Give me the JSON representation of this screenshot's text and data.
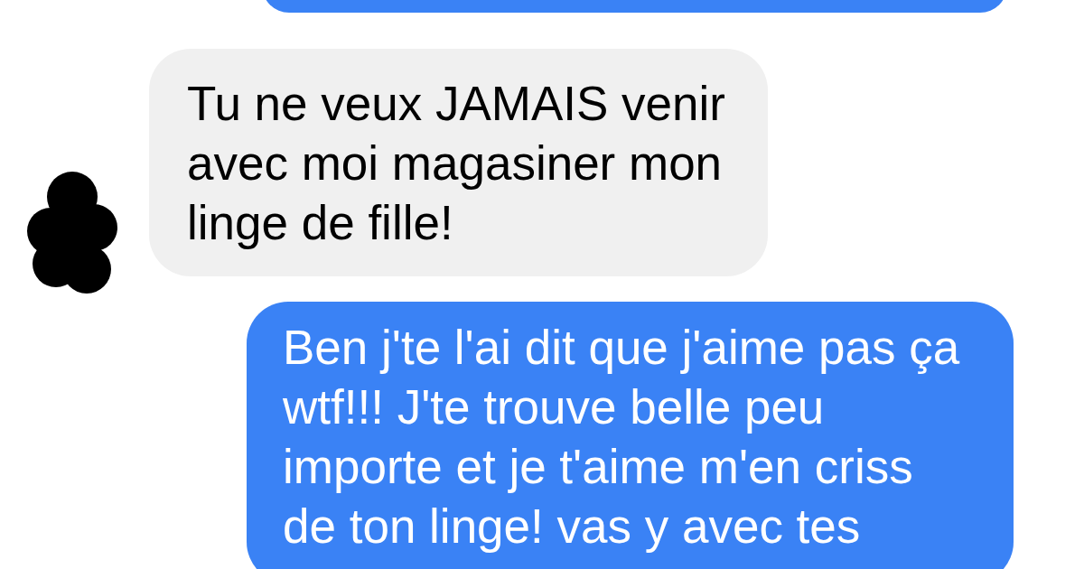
{
  "messages": [
    {
      "kind": "sent"
    },
    {
      "kind": "received",
      "text": "Tu ne veux JAMAIS venir avec moi magasiner mon linge de fille!"
    },
    {
      "kind": "sent",
      "text": "Ben j'te l'ai dit que j'aime pas ça wtf!!! J'te trouve belle peu importe et je t'aime m'en criss de ton linge! vas y avec tes"
    }
  ]
}
